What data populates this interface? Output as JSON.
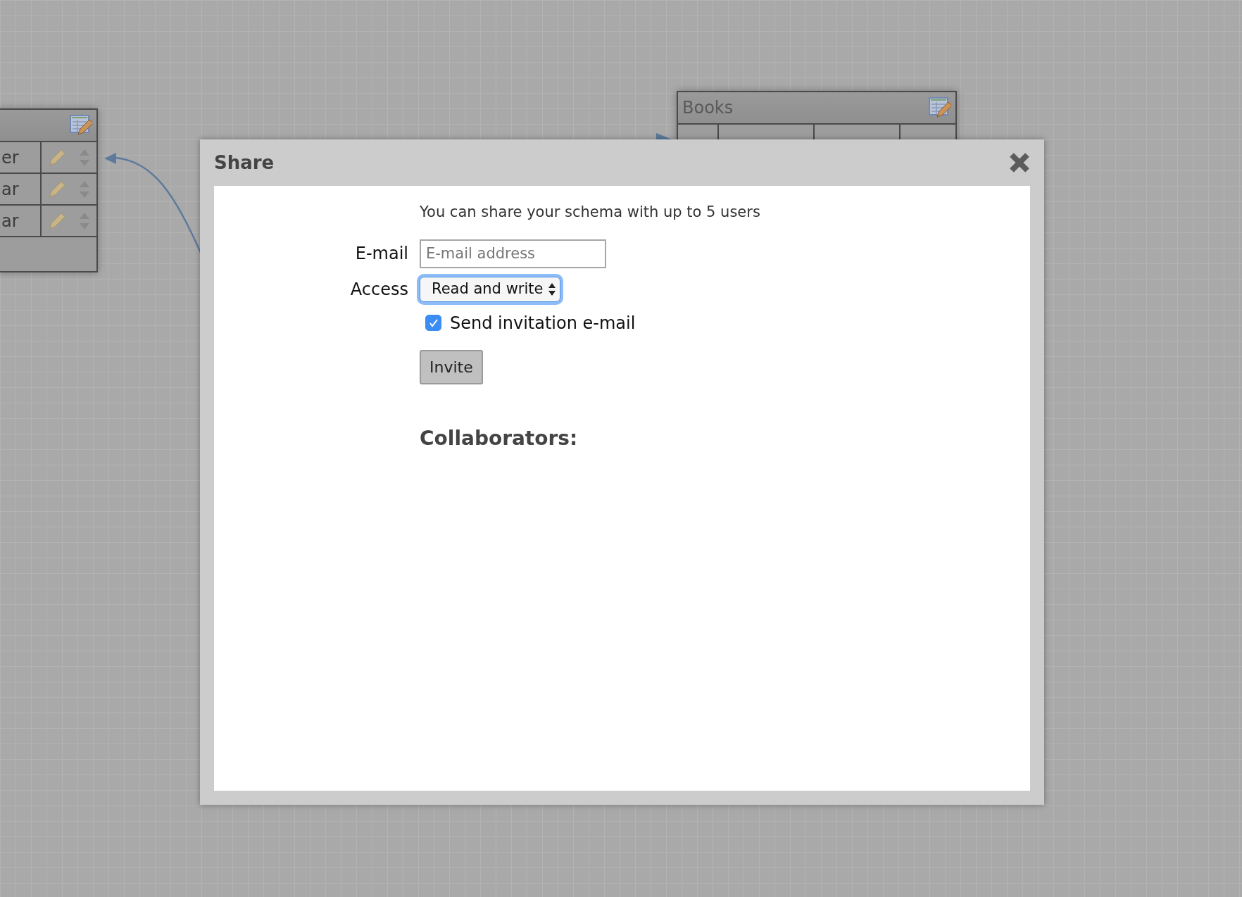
{
  "canvas": {
    "tables": [
      {
        "rows": [
          {
            "name": "er"
          },
          {
            "name": "ar"
          },
          {
            "name": "ar"
          }
        ]
      },
      {
        "title": "Books"
      }
    ]
  },
  "dialog": {
    "title": "Share",
    "intro": "You can share your schema with up to 5 users",
    "email": {
      "label": "E-mail",
      "placeholder": "E-mail address"
    },
    "access": {
      "label": "Access",
      "value": "Read and write",
      "focused": true
    },
    "send_invite": {
      "label": "Send invitation e-mail",
      "checked": true
    },
    "invite_button": "Invite",
    "collaborators_heading": "Collaborators:"
  }
}
